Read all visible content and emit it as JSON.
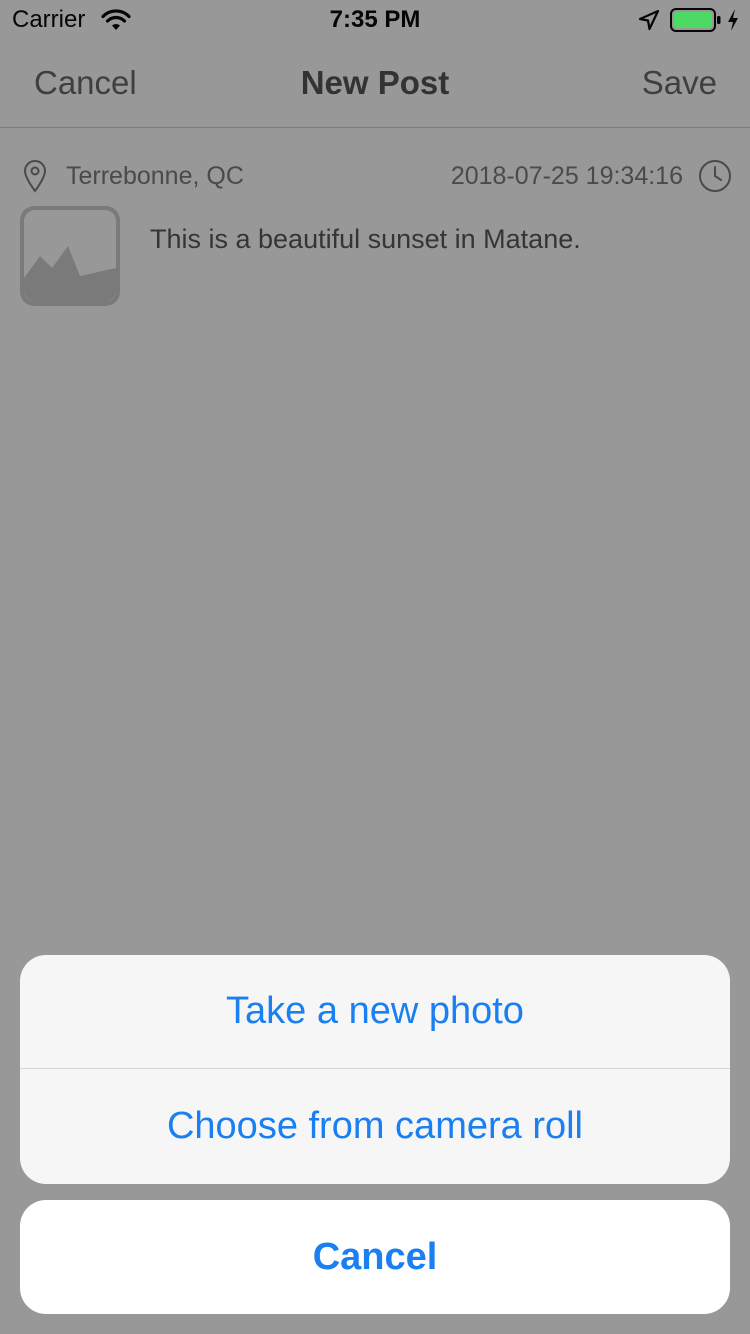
{
  "status_bar": {
    "carrier": "Carrier",
    "time": "7:35 PM",
    "battery_color": "#4cd964"
  },
  "nav": {
    "cancel": "Cancel",
    "title": "New Post",
    "save": "Save"
  },
  "post": {
    "location": "Terrebonne, QC",
    "datetime": "2018-07-25 19:34:16",
    "text": "This is a beautiful sunset in Matane."
  },
  "action_sheet": {
    "take_photo": "Take a new photo",
    "choose_roll": "Choose from camera roll",
    "cancel": "Cancel",
    "accent_color": "#1a7ff0"
  },
  "icons": [
    "wifi-icon",
    "location-arrow-icon",
    "battery-icon",
    "charging-icon",
    "pin-icon",
    "clock-icon",
    "photo-placeholder-icon"
  ]
}
